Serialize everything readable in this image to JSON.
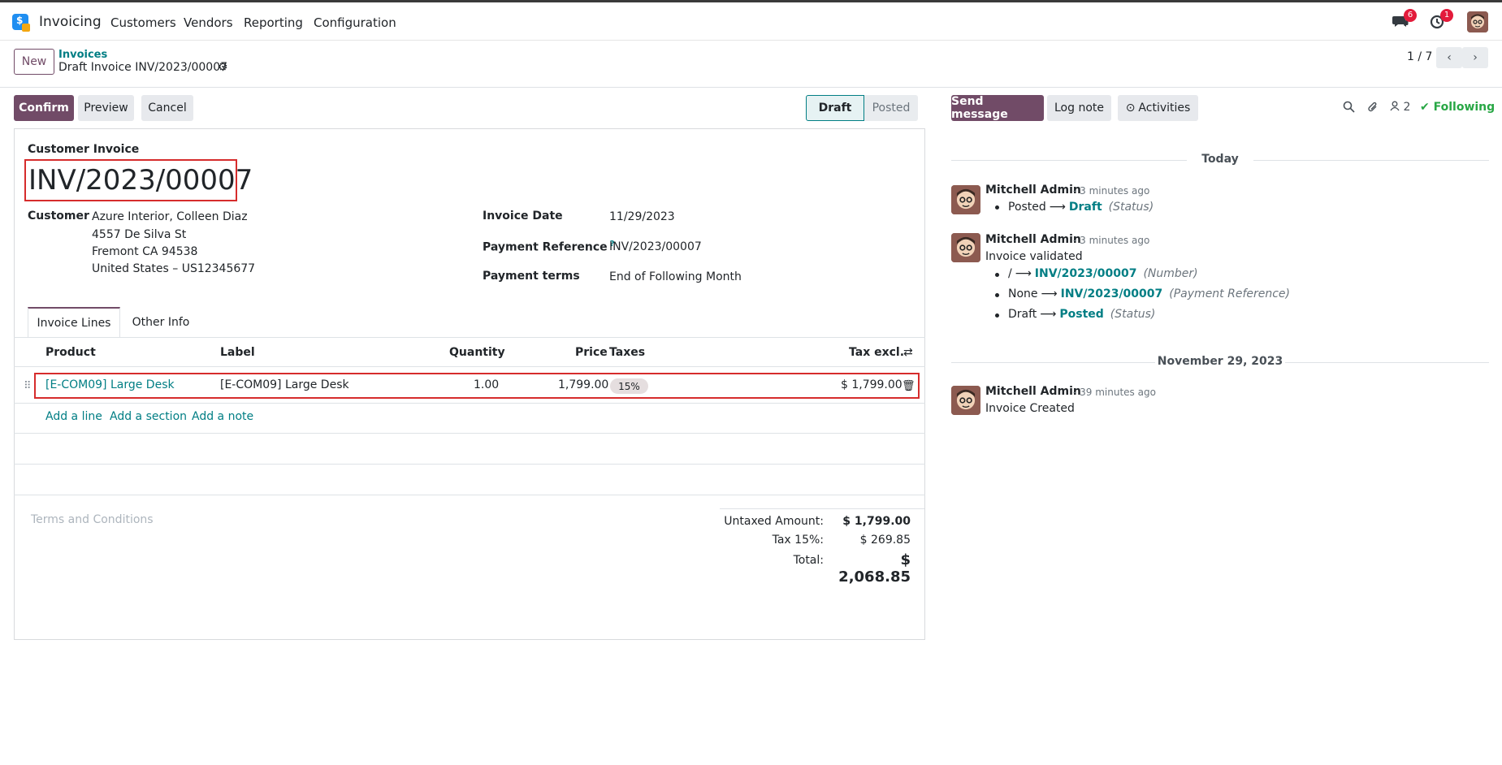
{
  "nav": {
    "app_name": "Invoicing",
    "menu": [
      "Customers",
      "Vendors",
      "Reporting",
      "Configuration"
    ],
    "messages_badge": "6",
    "activities_badge": "1"
  },
  "control_panel": {
    "new_label": "New",
    "breadcrumb_parent": "Invoices",
    "breadcrumb_current": "Draft Invoice INV/2023/00007",
    "pager": "1 / 7"
  },
  "actions": {
    "confirm": "Confirm",
    "preview": "Preview",
    "cancel": "Cancel"
  },
  "status": {
    "draft": "Draft",
    "posted": "Posted"
  },
  "invoice": {
    "type_label": "Customer Invoice",
    "number": "INV/2023/00007",
    "customer_label": "Customer",
    "customer_lines": [
      "Azure Interior, Colleen Diaz",
      "4557 De Silva St",
      "Fremont CA 94538",
      "United States – US12345677"
    ],
    "invoice_date_label": "Invoice Date",
    "invoice_date": "11/29/2023",
    "payment_ref_label": "Payment Reference",
    "payment_ref_help": "?",
    "payment_ref": "INV/2023/00007",
    "payment_terms_label": "Payment terms",
    "payment_terms": "End of Following Month"
  },
  "tabs": [
    "Invoice Lines",
    "Other Info"
  ],
  "lines": {
    "headers": {
      "product": "Product",
      "label": "Label",
      "quantity": "Quantity",
      "price": "Price",
      "taxes": "Taxes",
      "tax_excl": "Tax excl."
    },
    "rows": [
      {
        "product": "[E-COM09] Large Desk",
        "label": "[E-COM09] Large Desk",
        "quantity": "1.00",
        "price": "1,799.00",
        "tax": "15%",
        "subtotal": "$ 1,799.00"
      }
    ],
    "add_line": "Add a line",
    "add_section": "Add a section",
    "add_note": "Add a note"
  },
  "terms_placeholder": "Terms and Conditions",
  "totals": {
    "untaxed_label": "Untaxed Amount:",
    "untaxed_value": "$ 1,799.00",
    "tax_label": "Tax 15%:",
    "tax_value": "$ 269.85",
    "total_label": "Total:",
    "total_value": "$ 2,068.85"
  },
  "chatter": {
    "send_message": "Send message",
    "log_note": "Log note",
    "activities": "Activities",
    "followers_count": "2",
    "following": "Following",
    "today": "Today",
    "older_date": "November 29, 2023",
    "messages": [
      {
        "author": "Mitchell Admin",
        "time": "- 3 minutes ago",
        "changes": [
          {
            "old": "Posted",
            "new": "Draft",
            "field": "(Status)"
          }
        ]
      },
      {
        "author": "Mitchell Admin",
        "time": "- 3 minutes ago",
        "text": "Invoice validated",
        "changes": [
          {
            "old": "/",
            "new": "INV/2023/00007",
            "field": "(Number)"
          },
          {
            "old": "None",
            "new": "INV/2023/00007",
            "field": "(Payment Reference)"
          },
          {
            "old": "Draft",
            "new": "Posted",
            "field": "(Status)"
          }
        ]
      },
      {
        "author": "Mitchell Admin",
        "time": "- 39 minutes ago",
        "text": "Invoice Created"
      }
    ]
  },
  "colors": {
    "primary": "#714b67",
    "link": "#017e84",
    "highlight_box": "#d62c2c",
    "following": "#28a745",
    "badge": "#e31b3b"
  }
}
